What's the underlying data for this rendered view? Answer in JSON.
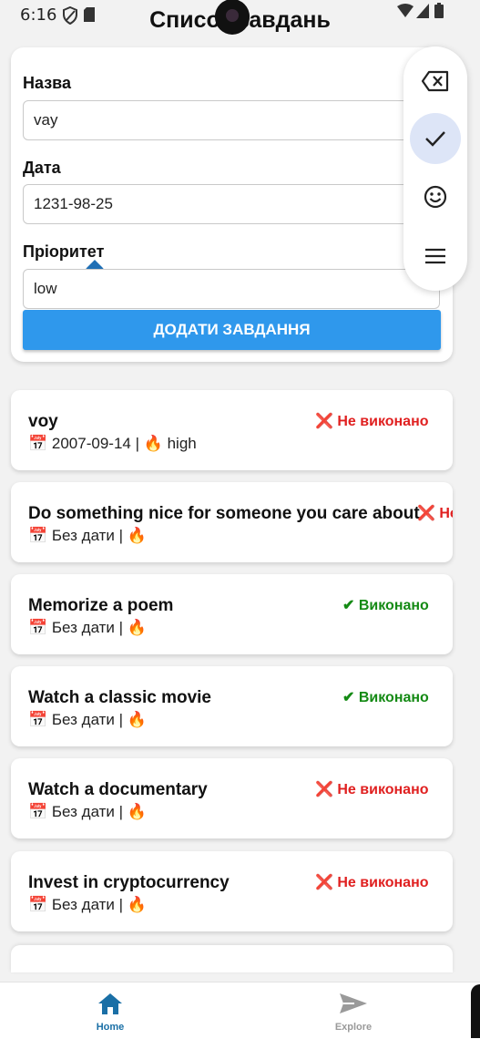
{
  "status_bar": {
    "time": "6:16"
  },
  "header": {
    "title": "Список завдань"
  },
  "form": {
    "name_label": "Назва",
    "name_value": "vay",
    "date_label": "Дата",
    "date_value": "1231-98-25",
    "priority_label": "Пріоритет",
    "priority_value": "low",
    "add_button": "ДОДАТИ ЗАВДАННЯ"
  },
  "keyboard_toolbar": {
    "icons": [
      "backspace-icon",
      "check-icon",
      "emoji-icon",
      "menu-icon"
    ],
    "active_color": "#dde5f7"
  },
  "tasks": [
    {
      "title": "voy",
      "meta": "📅 2007-09-14 | 🔥 high",
      "status": "❌ Не виконано",
      "done": false
    },
    {
      "title": "Do something nice for someone you care about",
      "meta": "📅 Без дати | 🔥",
      "status": "❌ Не виконано",
      "done": false
    },
    {
      "title": "Memorize a poem",
      "meta": "📅 Без дати | 🔥",
      "status": "✔ Виконано",
      "done": true
    },
    {
      "title": "Watch a classic movie",
      "meta": "📅 Без дати | 🔥",
      "status": "✔ Виконано",
      "done": true
    },
    {
      "title": "Watch a documentary",
      "meta": "📅 Без дати | 🔥",
      "status": "❌ Не виконано",
      "done": false
    },
    {
      "title": "Invest in cryptocurrency",
      "meta": "📅 Без дати | 🔥",
      "status": "❌ Не виконано",
      "done": false
    }
  ],
  "bottom_nav": {
    "home_label": "Home",
    "explore_label": "Explore",
    "active_color": "#1a6fa6",
    "inactive_color": "#9a9a9a"
  },
  "colors": {
    "primary_button": "#2f98ec",
    "status_not_done": "#e02020",
    "status_done": "#148a14"
  }
}
